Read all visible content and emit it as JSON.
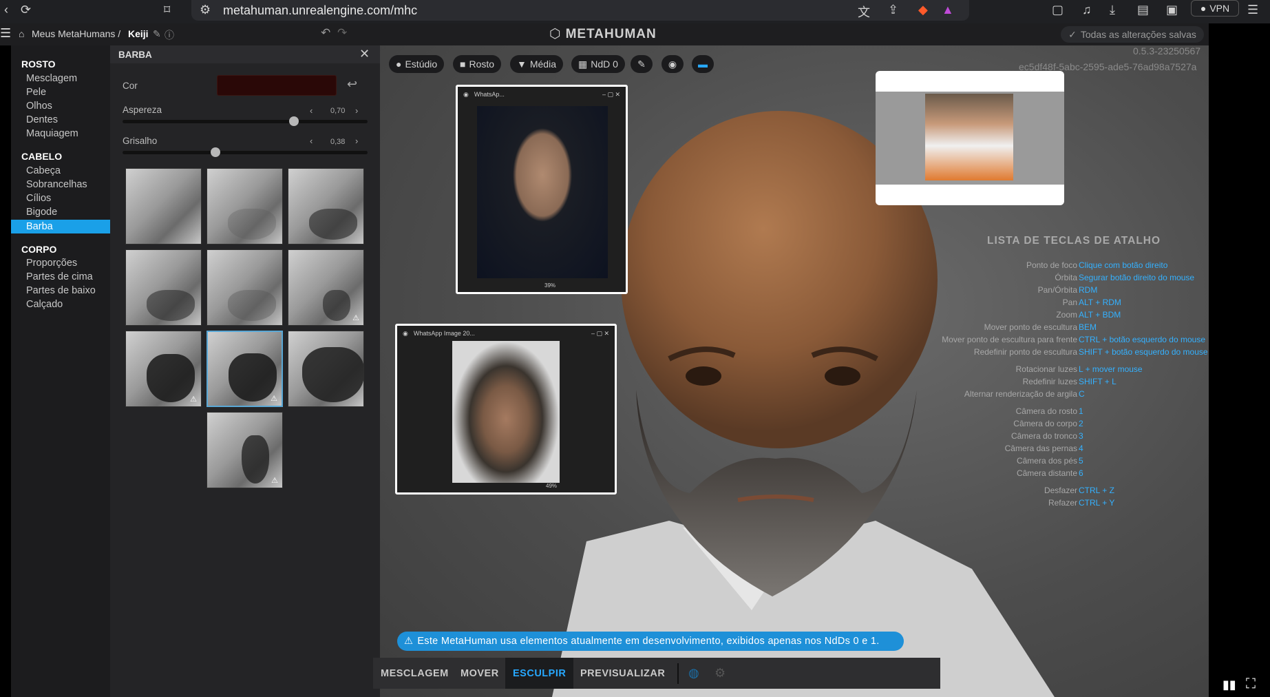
{
  "browser": {
    "url": "metahuman.unrealengine.com/mhc",
    "vpn_label": "VPN"
  },
  "header": {
    "breadcrumb_root": "Meus MetaHumans /",
    "character_name": "Keiji",
    "logo_text": "METAHUMAN",
    "saved_status": "Todas as alterações salvas"
  },
  "sidebar": {
    "sections": [
      {
        "title": "ROSTO",
        "items": [
          "Mesclagem",
          "Pele",
          "Olhos",
          "Dentes",
          "Maquiagem"
        ]
      },
      {
        "title": "CABELO",
        "items": [
          "Cabeça",
          "Sobrancelhas",
          "Cílios",
          "Bigode",
          "Barba"
        ]
      },
      {
        "title": "CORPO",
        "items": [
          "Proporções",
          "Partes de cima",
          "Partes de baixo",
          "Calçado"
        ]
      }
    ],
    "active_item": "Barba"
  },
  "panel": {
    "title": "BARBA",
    "color_label": "Cor",
    "color_value": "#2a0807",
    "roughness_label": "Aspereza",
    "roughness_value": "0,70",
    "roughness_level": 0.7,
    "gray_label": "Grisalho",
    "gray_value": "0,38",
    "gray_level": 0.38
  },
  "viewport": {
    "buttons": [
      "Estúdio",
      "Rosto",
      "Média",
      "NdD 0"
    ],
    "version": "0.5.3-23250567",
    "hash": "ec5df48f-5abc-2595-ade5-76ad98a7527a"
  },
  "windows": {
    "win1_title": "WhatsAp...",
    "win1_zoom": "39%",
    "win2_title": "WhatsApp Image 20...",
    "win2_zoom": "49%"
  },
  "shortcuts": {
    "title": "LISTA DE TECLAS DE ATALHO",
    "items": [
      {
        "action": "Ponto de foco",
        "key": "Clique com botão direito"
      },
      {
        "action": "Órbita",
        "key": "Segurar botão direito do mouse"
      },
      {
        "action": "Pan/Órbita",
        "key": "RDM"
      },
      {
        "action": "Pan",
        "key": "ALT + RDM"
      },
      {
        "action": "Zoom",
        "key": "ALT + BDM"
      },
      {
        "action": "Mover ponto de escultura",
        "key": "BEM"
      },
      {
        "action": "Mover ponto de escultura para frente",
        "key": "CTRL + botão esquerdo do mouse"
      },
      {
        "action": "Redefinir ponto de escultura",
        "key": "SHIFT + botão esquerdo do mouse"
      },
      {
        "action": "Rotacionar luzes",
        "key": "L + mover mouse"
      },
      {
        "action": "Redefinir luzes",
        "key": "SHIFT + L"
      },
      {
        "action": "Alternar renderização de argila",
        "key": "C"
      },
      {
        "action": "Câmera do rosto",
        "key": "1"
      },
      {
        "action": "Câmera do corpo",
        "key": "2"
      },
      {
        "action": "Câmera do tronco",
        "key": "3"
      },
      {
        "action": "Câmera das pernas",
        "key": "4"
      },
      {
        "action": "Câmera dos pés",
        "key": "5"
      },
      {
        "action": "Câmera distante",
        "key": "6"
      },
      {
        "action": "Desfazer",
        "key": "CTRL + Z"
      },
      {
        "action": "Refazer",
        "key": "CTRL + Y"
      }
    ]
  },
  "banner": {
    "text": "Este MetaHuman usa elementos atualmente em desenvolvimento, exibidos apenas nos NdDs 0 e 1."
  },
  "bottom_tabs": [
    "MESCLAGEM",
    "MOVER",
    "ESCULPIR",
    "PREVISUALIZAR"
  ],
  "active_tab": "ESCULPIR",
  "colors": {
    "accent": "#1aa0e8",
    "link": "#34b1ff",
    "banner": "#1e90d8"
  }
}
